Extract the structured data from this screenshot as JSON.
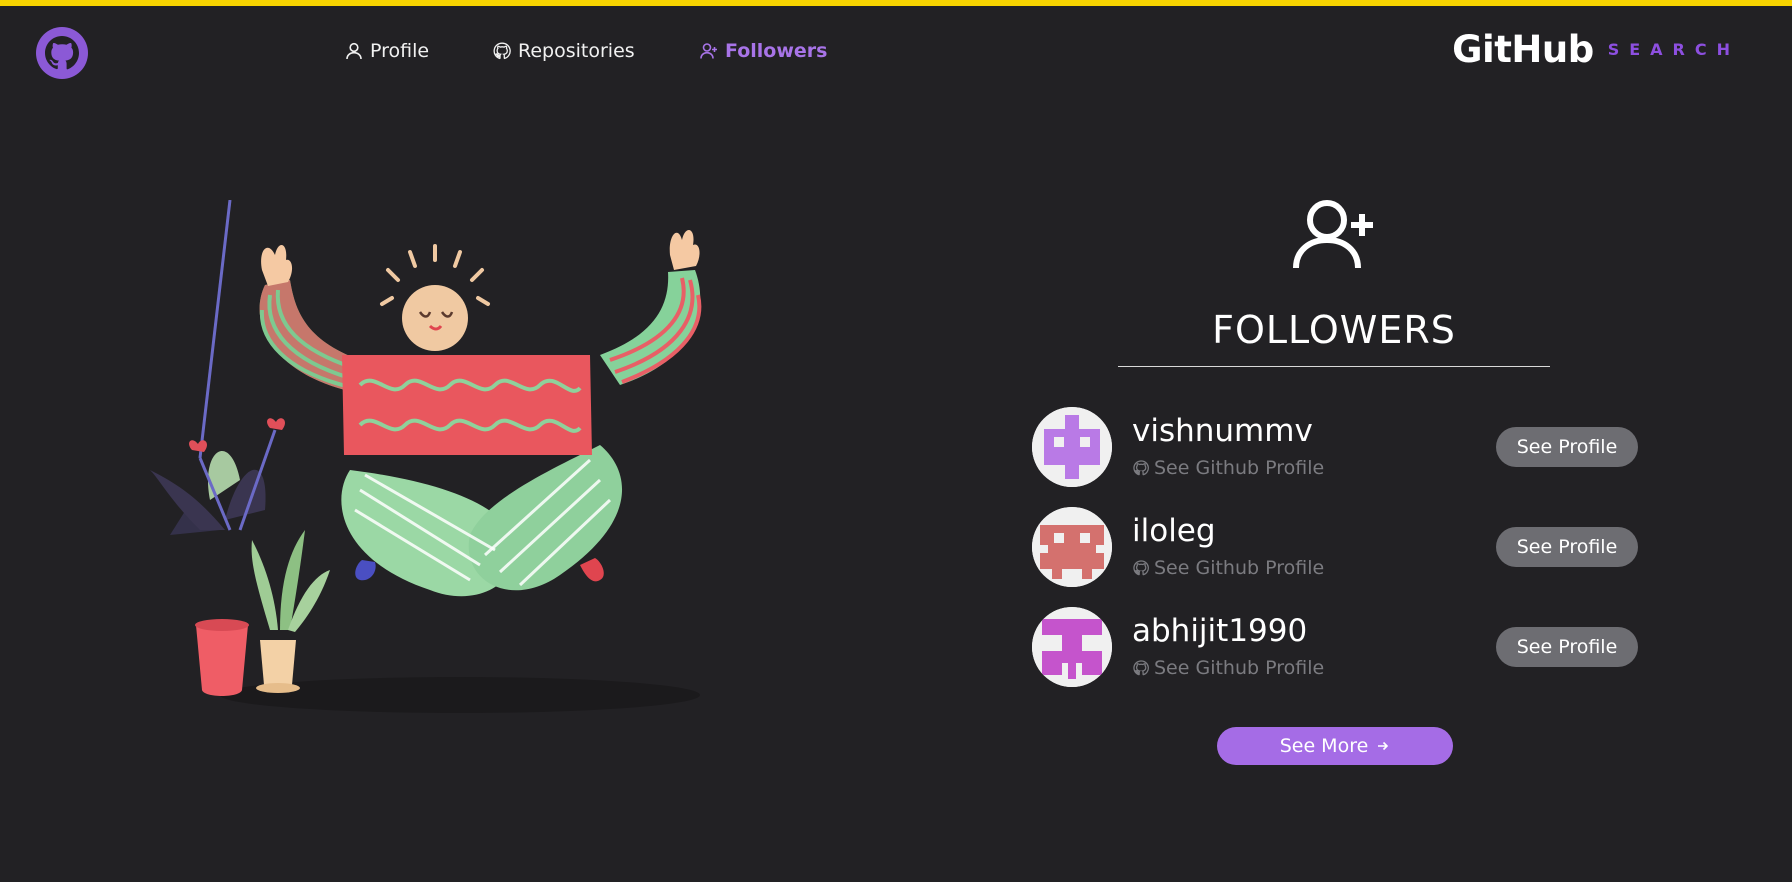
{
  "nav": {
    "items": [
      {
        "label": "Profile",
        "icon": "user-icon"
      },
      {
        "label": "Repositories",
        "icon": "github-icon"
      },
      {
        "label": "Followers",
        "icon": "user-plus-icon"
      }
    ],
    "active": "Followers"
  },
  "brand": {
    "main": "GitHub",
    "sub": "SEARCH"
  },
  "panel": {
    "title": "FOLLOWERS",
    "icon": "user-plus-icon"
  },
  "followers": [
    {
      "username": "vishnummv",
      "github_link": "See Github Profile",
      "button": "See Profile",
      "avatar_color": "#b97ae6"
    },
    {
      "username": "iloleg",
      "github_link": "See Github Profile",
      "button": "See Profile",
      "avatar_color": "#d4716e"
    },
    {
      "username": "abhijit1990",
      "github_link": "See Github Profile",
      "button": "See Profile",
      "avatar_color": "#c554cc"
    }
  ],
  "see_more": {
    "label": "See More",
    "icon": "arrow-right-icon"
  },
  "colors": {
    "accent": "#a874e8",
    "top_bar": "#f7d300",
    "background": "#222124"
  }
}
